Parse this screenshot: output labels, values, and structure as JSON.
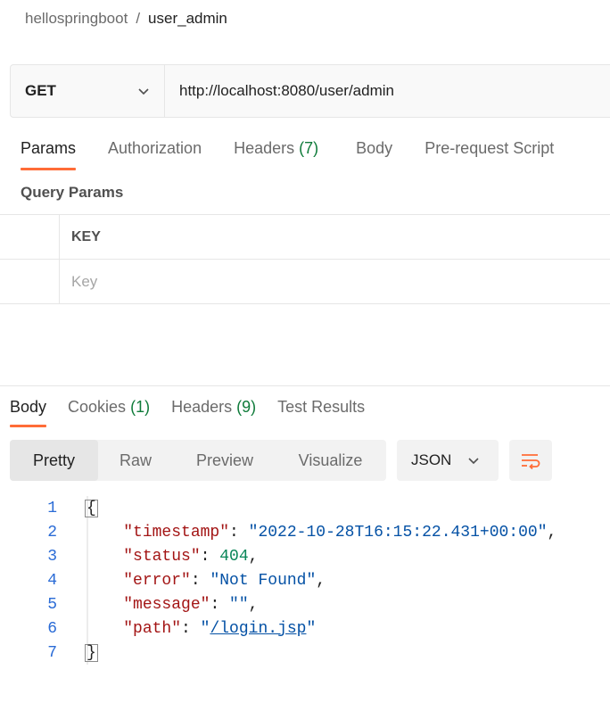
{
  "breadcrumb": {
    "parent": "hellospringboot",
    "separator": "/",
    "current": "user_admin"
  },
  "request": {
    "method": "GET",
    "url": "http://localhost:8080/user/admin"
  },
  "request_tabs": {
    "params": "Params",
    "authorization": "Authorization",
    "headers": "Headers",
    "headers_count": "(7)",
    "body": "Body",
    "prerequest": "Pre-request Script"
  },
  "query_params": {
    "title": "Query Params",
    "key_header": "KEY",
    "key_placeholder": "Key"
  },
  "response_tabs": {
    "body": "Body",
    "cookies": "Cookies",
    "cookies_count": "(1)",
    "headers": "Headers",
    "headers_count": "(9)",
    "test_results": "Test Results"
  },
  "view_modes": {
    "pretty": "Pretty",
    "raw": "Raw",
    "preview": "Preview",
    "visualize": "Visualize"
  },
  "format": "JSON",
  "response_body": {
    "line_numbers": [
      "1",
      "2",
      "3",
      "4",
      "5",
      "6",
      "7"
    ],
    "open_brace": "{",
    "close_brace": "}",
    "timestamp_key": "\"timestamp\"",
    "timestamp_value": "\"2022-10-28T16:15:22.431+00:00\"",
    "status_key": "\"status\"",
    "status_value": "404",
    "error_key": "\"error\"",
    "error_value": "\"Not Found\"",
    "message_key": "\"message\"",
    "message_value": "\"\"",
    "path_key": "\"path\"",
    "path_value": "/login.jsp"
  },
  "colors": {
    "accent": "#ff6c37",
    "count_green": "#0f7b3a",
    "json_key": "#a31515",
    "json_string": "#0451a5",
    "json_number": "#098658"
  }
}
